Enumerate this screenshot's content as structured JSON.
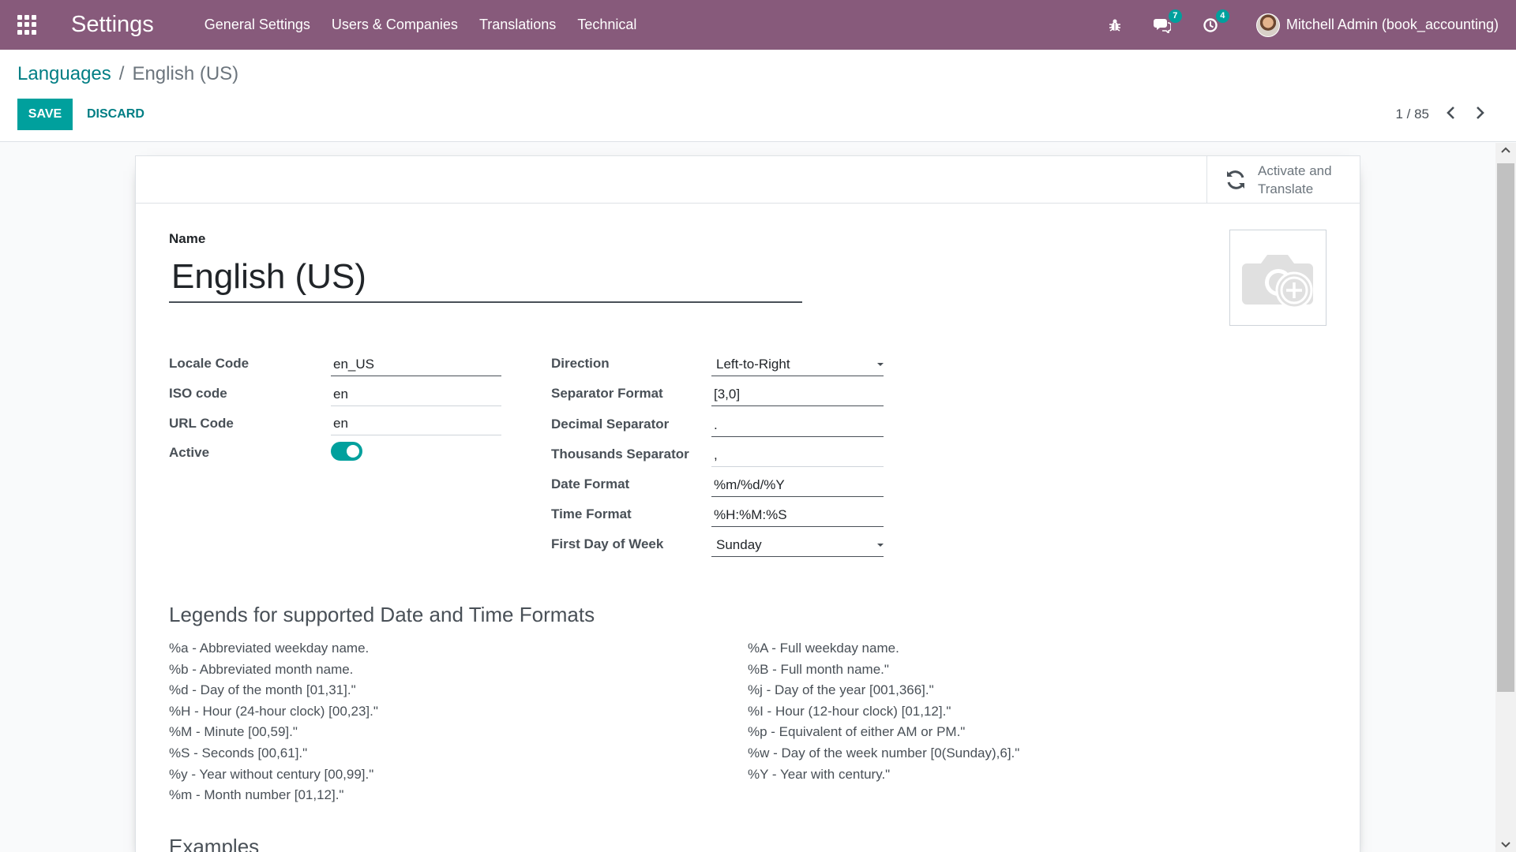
{
  "navbar": {
    "app_title": "Settings",
    "menu": [
      "General Settings",
      "Users & Companies",
      "Translations",
      "Technical"
    ],
    "messages_count": "7",
    "activities_count": "4",
    "user_name": "Mitchell Admin (book_accounting)"
  },
  "breadcrumb": {
    "parent": "Languages",
    "separator": "/",
    "current": "English (US)"
  },
  "control": {
    "save_label": "SAVE",
    "discard_label": "DISCARD",
    "pager": "1 / 85"
  },
  "stat_button": {
    "label": "Activate and Translate"
  },
  "form": {
    "name_label": "Name",
    "name_value": "English (US)",
    "left_fields": [
      {
        "label": "Locale Code",
        "value": "en_US"
      },
      {
        "label": "ISO code",
        "value": "en"
      },
      {
        "label": "URL Code",
        "value": "en"
      },
      {
        "label": "Active",
        "value": true
      }
    ],
    "right_fields": [
      {
        "label": "Direction",
        "value": "Left-to-Right"
      },
      {
        "label": "Separator Format",
        "value": "[3,0]"
      },
      {
        "label": "Decimal Separator",
        "value": "."
      },
      {
        "label": "Thousands Separator",
        "value": ","
      },
      {
        "label": "Date Format",
        "value": "%m/%d/%Y"
      },
      {
        "label": "Time Format",
        "value": "%H:%M:%S"
      },
      {
        "label": "First Day of Week",
        "value": "Sunday"
      }
    ]
  },
  "legend": {
    "title": "Legends for supported Date and Time Formats",
    "left": [
      "%a - Abbreviated weekday name.",
      "%b - Abbreviated month name.",
      "%d - Day of the month [01,31].\"",
      "%H - Hour (24-hour clock) [00,23].\"",
      "%M - Minute [00,59].\"",
      "%S - Seconds [00,61].\"",
      "%y - Year without century [00,99].\"",
      "%m - Month number [01,12].\""
    ],
    "right": [
      "%A - Full weekday name.",
      "%B - Full month name.\"",
      "%j - Day of the year [001,366].\"",
      "%I - Hour (12-hour clock) [01,12].\"",
      "%p - Equivalent of either AM or PM.\"",
      "%w - Day of the week number [0(Sunday),6].\"",
      "%Y - Year with century.\""
    ]
  },
  "examples": {
    "title": "Examples"
  },
  "colors": {
    "brand": "#875a7b",
    "accent": "#00a09d",
    "link": "#017e84"
  }
}
